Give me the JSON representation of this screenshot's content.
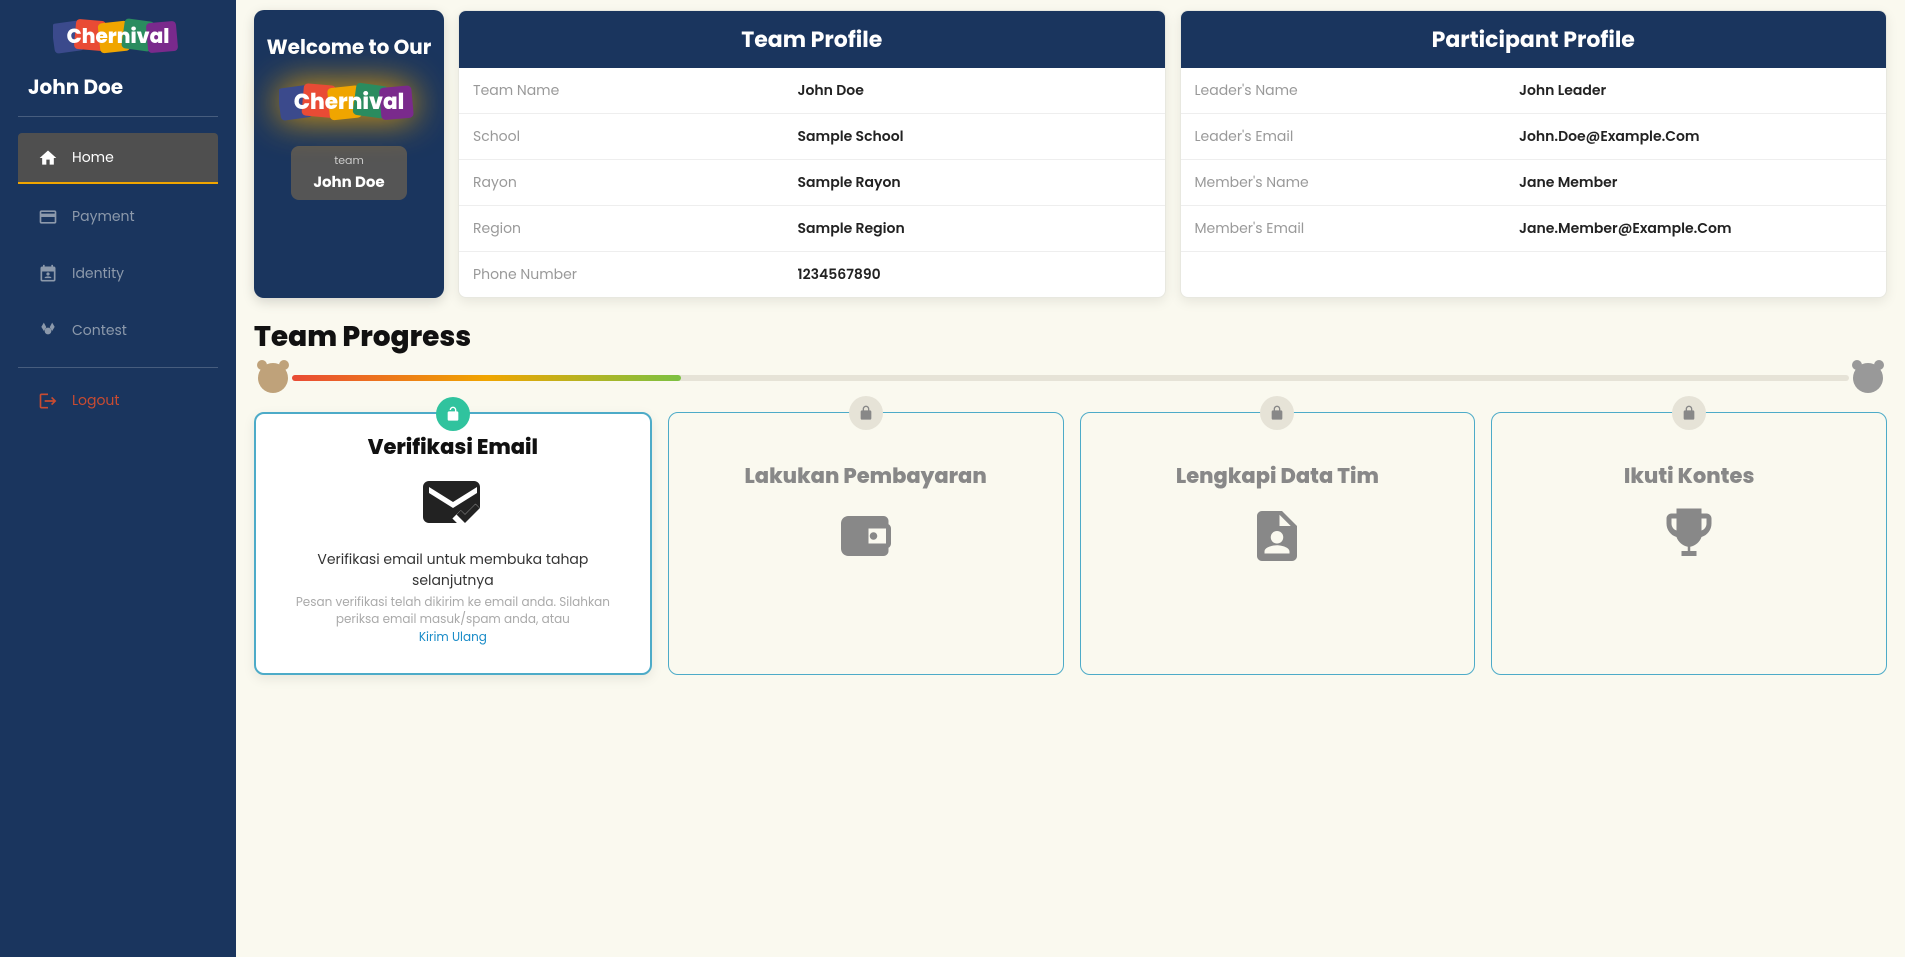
{
  "brand": "Chernival",
  "user": {
    "name": "John Doe"
  },
  "sidebar": {
    "items": [
      {
        "label": "Home",
        "active": true
      },
      {
        "label": "Payment",
        "active": false
      },
      {
        "label": "Identity",
        "active": false
      },
      {
        "label": "Contest",
        "active": false
      }
    ],
    "logout_label": "Logout"
  },
  "welcome": {
    "title": "Welcome to Our",
    "team_label": "team",
    "team_name": "John Doe"
  },
  "team_profile": {
    "title": "Team Profile",
    "rows": [
      {
        "label": "Team Name",
        "value": "John Doe"
      },
      {
        "label": "School",
        "value": "Sample School"
      },
      {
        "label": "Rayon",
        "value": "Sample Rayon"
      },
      {
        "label": "Region",
        "value": "Sample Region"
      },
      {
        "label": "Phone Number",
        "value": "1234567890"
      }
    ]
  },
  "participant_profile": {
    "title": "Participant Profile",
    "rows": [
      {
        "label": "Leader's Name",
        "value": "John Leader"
      },
      {
        "label": "Leader's Email",
        "value": "John.Doe@Example.Com"
      },
      {
        "label": "Member's Name",
        "value": "Jane Member"
      },
      {
        "label": "Member's Email",
        "value": "Jane.Member@Example.Com"
      }
    ]
  },
  "progress": {
    "title": "Team Progress",
    "percent": 25,
    "steps": [
      {
        "title": "Verifikasi Email",
        "locked": false,
        "desc": "Verifikasi email untuk membuka tahap selanjutnya",
        "sub": "Pesan verifikasi telah dikirim ke email anda. Silahkan periksa email masuk/spam anda, atau",
        "link": "Kirim Ulang"
      },
      {
        "title": "Lakukan Pembayaran",
        "locked": true
      },
      {
        "title": "Lengkapi Data Tim",
        "locked": true
      },
      {
        "title": "Ikuti Kontes",
        "locked": true
      }
    ]
  }
}
